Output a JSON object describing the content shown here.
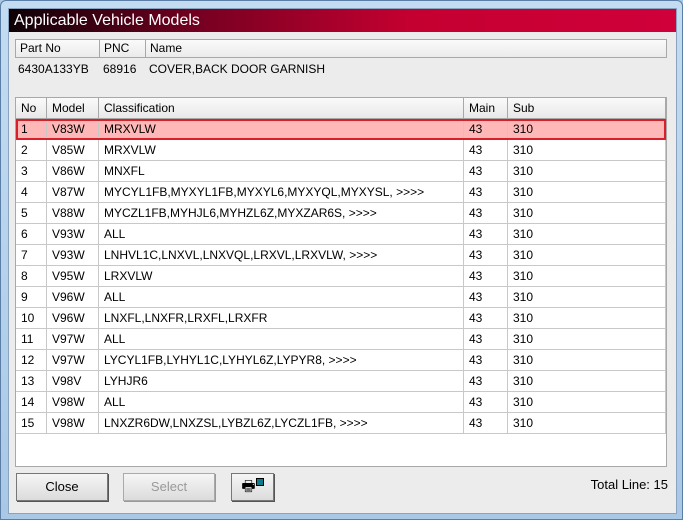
{
  "window": {
    "title": "Applicable Vehicle Models"
  },
  "part": {
    "headers": [
      "Part No",
      "PNC",
      "Name"
    ],
    "part_no": "6430A133YB",
    "pnc": "68916",
    "name": "COVER,BACK DOOR GARNISH"
  },
  "table": {
    "headers": [
      "No",
      "Model",
      "Classification",
      "Main",
      "Sub"
    ],
    "rows": [
      [
        "1",
        "V83W",
        "MRXVLW",
        "43",
        "310"
      ],
      [
        "2",
        "V85W",
        "MRXVLW",
        "43",
        "310"
      ],
      [
        "3",
        "V86W",
        "MNXFL",
        "43",
        "310"
      ],
      [
        "4",
        "V87W",
        "MYCYL1FB,MYXYL1FB,MYXYL6,MYXYQL,MYXYSL,  >>>>",
        "43",
        "310"
      ],
      [
        "5",
        "V88W",
        "MYCZL1FB,MYHJL6,MYHZL6Z,MYXZAR6S,  >>>>",
        "43",
        "310"
      ],
      [
        "6",
        "V93W",
        "ALL",
        "43",
        "310"
      ],
      [
        "7",
        "V93W",
        "LNHVL1C,LNXVL,LNXVQL,LRXVL,LRXVLW,  >>>>",
        "43",
        "310"
      ],
      [
        "8",
        "V95W",
        "LRXVLW",
        "43",
        "310"
      ],
      [
        "9",
        "V96W",
        "ALL",
        "43",
        "310"
      ],
      [
        "10",
        "V96W",
        "LNXFL,LNXFR,LRXFL,LRXFR",
        "43",
        "310"
      ],
      [
        "11",
        "V97W",
        "ALL",
        "43",
        "310"
      ],
      [
        "12",
        "V97W",
        "LYCYL1FB,LYHYL1C,LYHYL6Z,LYPYR8,  >>>>",
        "43",
        "310"
      ],
      [
        "13",
        "V98V",
        "LYHJR6",
        "43",
        "310"
      ],
      [
        "14",
        "V98W",
        "ALL",
        "43",
        "310"
      ],
      [
        "15",
        "V98W",
        "LNXZR6DW,LNXZSL,LYBZL6Z,LYCZL1FB,  >>>>",
        "43",
        "310"
      ]
    ],
    "selected_index": 0
  },
  "buttons": {
    "close": "Close",
    "select": "Select",
    "print_icon": "printer-icon"
  },
  "status": {
    "total_line": "Total Line: 15"
  }
}
